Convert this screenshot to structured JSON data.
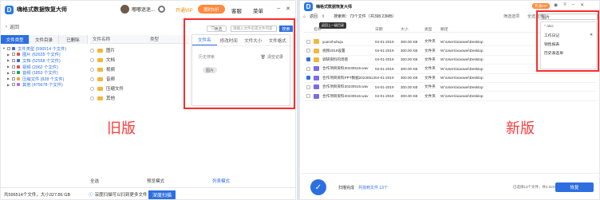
{
  "left": {
    "app_title": "嗨格式数据恢复大师",
    "username": "嘟嘟迷迷...",
    "vip_label": "开通VIP",
    "discount_label": "限时5折",
    "menu": [
      "客服",
      "菜单"
    ],
    "back_label": "返回",
    "tabs": [
      "文件类型",
      "文件目录",
      "已删除"
    ],
    "tree_root": "文件类型 (596514 个文件)",
    "tree": [
      {
        "label": "图片 (62635 个文件)",
        "color": "#e84b4b"
      },
      {
        "label": "文档 (52558 个文件)",
        "color": "#2d6fe0"
      },
      {
        "label": "视频 (2962 个文件)",
        "color": "#e84b4b"
      },
      {
        "label": "音频 (1853 个文件)",
        "color": "#19a35b"
      },
      {
        "label": "压缩文件 (828 个文件)",
        "color": "#f2a23a"
      },
      {
        "label": "其他 (475678 个文件)",
        "color": "#b56cf0"
      }
    ],
    "table_header": [
      "文件名称",
      "类型"
    ],
    "folders": [
      "图片",
      "文档",
      "视频",
      "音频",
      "压缩文件",
      "其他"
    ],
    "filter_label": "筛选",
    "search_placeholder": "请输入文件名或文件内容",
    "search_button": "搜索",
    "popup_tabs": [
      "文件名",
      "修改时间",
      "文件大小",
      "文件格式"
    ],
    "history_label": "历史搜索",
    "clear_label": "清空记录",
    "history_tag": "图片",
    "old_label": "旧版",
    "footer_select_all": "全选",
    "footer_preview": "预览模式",
    "footer_list": "列表模式",
    "footer_note": "共596514个文件，大小327.86 GB",
    "banner": "深度扫描可以扫到更多文件",
    "recover_button": "深度扫描"
  },
  "right": {
    "app_title": "嗨格式数据恢复大师",
    "vip_label": "开通VIP",
    "nav_back": "返回",
    "nav_summary": "搜索到：73个文件（共398.23MB）",
    "tooltip": "返回上一级目录",
    "tools": [
      "筛选选项",
      "全选显示"
    ],
    "search_value": "图片",
    "columns": [
      "名称",
      "日期",
      "大小",
      "类型",
      "路径"
    ],
    "rows": [
      {
        "name": "yuanzhuhuju",
        "date": "04-01-2019",
        "size": "300.00 KB",
        "type": "文件夹",
        "path": "W:\\Users\\xiaowei\\Desktop",
        "icon": "folder",
        "checked": false
      },
      {
        "name": "视频2019设置",
        "date": "04-01-2019",
        "size": "300.00 KB",
        "type": "文件夹",
        "path": "W:\\Users\\xiaowei\\Desktop",
        "icon": "folder",
        "checked": false
      },
      {
        "name": "调研资料的场景",
        "date": "04-01-2019",
        "size": "300.00 KB",
        "type": "文件夹",
        "path": "W:\\Users\\xiaowei\\Desktop",
        "icon": "folder",
        "checked": true
      },
      {
        "name": "合作项目资料20230516.wav",
        "date": "04-01-2019",
        "size": "300.00 KB",
        "type": "文件夹",
        "path": "W:\\Users\\xiaowei\\Desktop",
        "icon": "zip",
        "checked": false
      },
      {
        "name": "合作项目资料PPT数据20230512...",
        "date": "04-01-2019",
        "size": "300.00 KB",
        "type": "文件夹",
        "path": "W:\\Users\\xiaowei\\Desktop",
        "icon": "zip",
        "checked": true
      },
      {
        "name": "合作项目资料20230516.wav",
        "date": "04-01-2019",
        "size": "300.00 KB",
        "type": "文件夹",
        "path": "W:\\Users\\xiaowei\\Desktop",
        "icon": "zip",
        "checked": false
      },
      {
        "name": "合作项目资料20230516.wav",
        "date": "04-01-2019",
        "size": "300.00 KB",
        "type": "文件夹",
        "path": "W:\\Users\\xiaowei\\Desktop",
        "icon": "zip",
        "checked": false
      }
    ],
    "dropdown": [
      "* alac",
      "工作日记",
      "销售报表",
      "历史表选单"
    ],
    "new_label": "新版",
    "scan_done": "扫描完成",
    "scan_count": "共找到文件 13个",
    "selected": "已选择13个文件，共4.02G大小",
    "recover_button": "恢复"
  }
}
